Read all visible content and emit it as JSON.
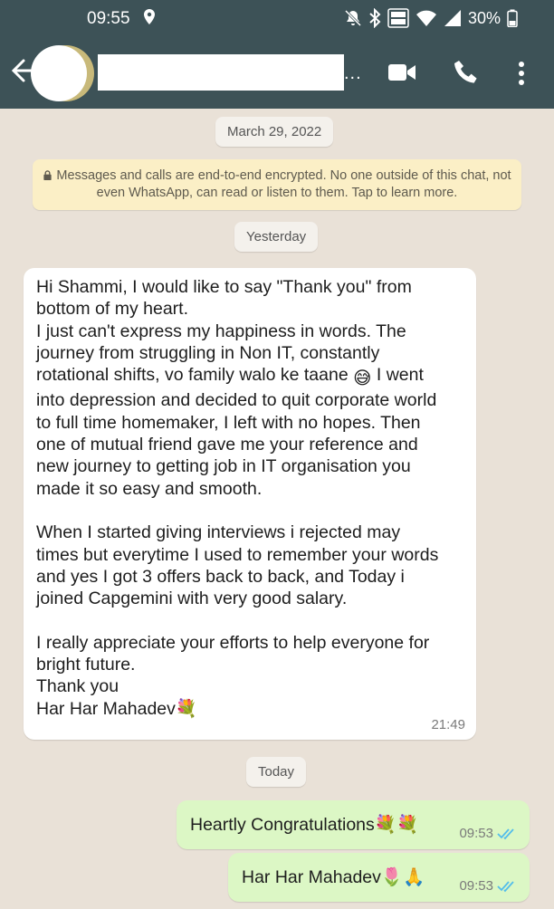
{
  "status_bar": {
    "time": "09:55",
    "battery": "30%",
    "icons": [
      "location-icon",
      "mute-icon",
      "bluetooth-icon",
      "vowifi-icon",
      "wifi-icon",
      "signal-icon",
      "battery-icon"
    ]
  },
  "header": {
    "contact_ellipsis": "...",
    "icons": [
      "back-arrow-icon",
      "video-call-icon",
      "voice-call-icon",
      "more-menu-icon"
    ]
  },
  "chat": {
    "date_1": "March 29, 2022",
    "encryption_notice": "Messages and calls are end-to-end encrypted. No one outside of this chat, not even WhatsApp, can read or listen to them. Tap to learn more.",
    "date_2": "Yesterday",
    "incoming": {
      "part1": "Hi Shammi, I would like to say \"Thank you\" from\nbottom of my heart.\nI just can't express my happiness in words. The\njourney from struggling in Non IT, constantly\nrotational shifts, vo family walo ke taane ",
      "emoji_1": "😅",
      "part2": " I went\ninto depression and decided to quit corporate world\nto full time homemaker, I left with no hopes. Then\none of mutual friend gave me your reference and\nnew journey to getting job in IT organisation you\nmade it so easy and smooth.\n\nWhen I started giving interviews i rejected may\ntimes but everytime I used to remember your words\nand yes I got 3 offers back to back, and Today i\njoined Capgemini with very good salary.\n\nI really appreciate your efforts to help everyone for\nbright future.\nThank you\nHar Har Mahadev",
      "emoji_2": "💐",
      "time": "21:49"
    },
    "date_3": "Today",
    "outgoing": [
      {
        "text": "Heartly Congratulations",
        "emojis": "💐💐",
        "time": "09:53"
      },
      {
        "text": "Har Har Mahadev",
        "emojis": "🌷🙏",
        "time": "09:53"
      }
    ],
    "colors": {
      "header": "#3d5257",
      "chat_bg": "#e9e1d7",
      "outgoing_bubble": "#dcf7c5",
      "read_ticks": "#53bdeb"
    }
  }
}
